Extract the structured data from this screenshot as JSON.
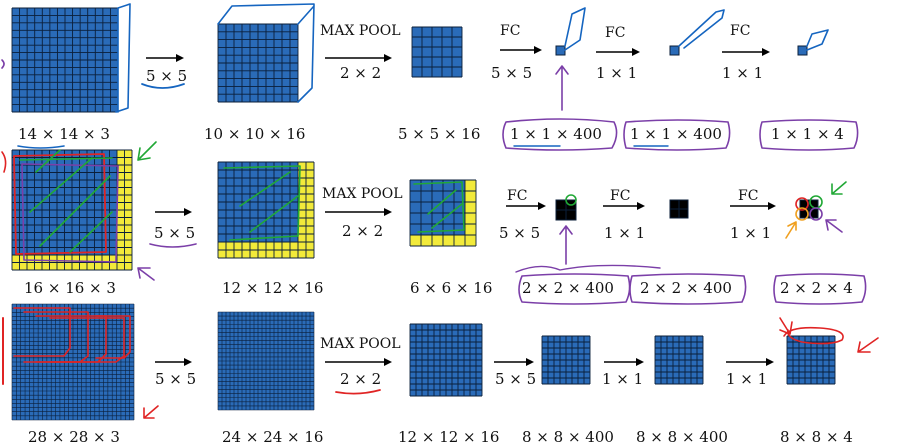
{
  "rows": [
    {
      "input_label": "14 × 14 × 3",
      "conv_op": "5 × 5",
      "conv_label": "10 × 10 × 16",
      "pool_label": "MAX POOL",
      "pool_op": "2 × 2",
      "pool_out_label": "5 × 5 × 16",
      "fc_label": "FC",
      "fc1_op": "5 × 5",
      "fc1_out": "1 × 1 × 400",
      "fc2_op": "1 × 1",
      "fc2_out": "1 × 1 × 400",
      "fc3_op": "1 × 1",
      "fc3_out": "1 × 1 × 4"
    },
    {
      "input_label": "16 × 16 × 3",
      "conv_op": "5 × 5",
      "conv_label": "12 × 12 × 16",
      "pool_label": "MAX POOL",
      "pool_op": "2 × 2",
      "pool_out_label": "6 × 6 × 16",
      "fc_label": "FC",
      "fc1_op": "5 × 5",
      "fc1_out": "2 × 2 × 400",
      "fc2_op": "1 × 1",
      "fc2_out": "2 × 2 × 400",
      "fc3_op": "1 × 1",
      "fc3_out": "2 × 2 × 4"
    },
    {
      "input_label": "28 × 28 × 3",
      "conv_op": "5 × 5",
      "conv_label": "24 × 24 × 16",
      "pool_label": "MAX POOL",
      "pool_op": "2 × 2",
      "pool_out_label": "12 × 12 × 16",
      "fc1_op": "5 × 5",
      "fc1_out": "8 × 8 × 400",
      "fc2_op": "1 × 1",
      "fc2_out": "8 × 8 × 400",
      "fc3_op": "1 × 1",
      "fc3_out": "8 × 8 × 4"
    }
  ],
  "colors": {
    "grid_fill": "#2a6bb8",
    "grid_line": "#0b1f3a",
    "highlight": "#f2ea3a",
    "ink_blue": "#1565c0",
    "ink_purple": "#7b3fa8",
    "ink_green": "#21a836",
    "ink_red": "#e02424",
    "ink_orange": "#f0a020"
  }
}
